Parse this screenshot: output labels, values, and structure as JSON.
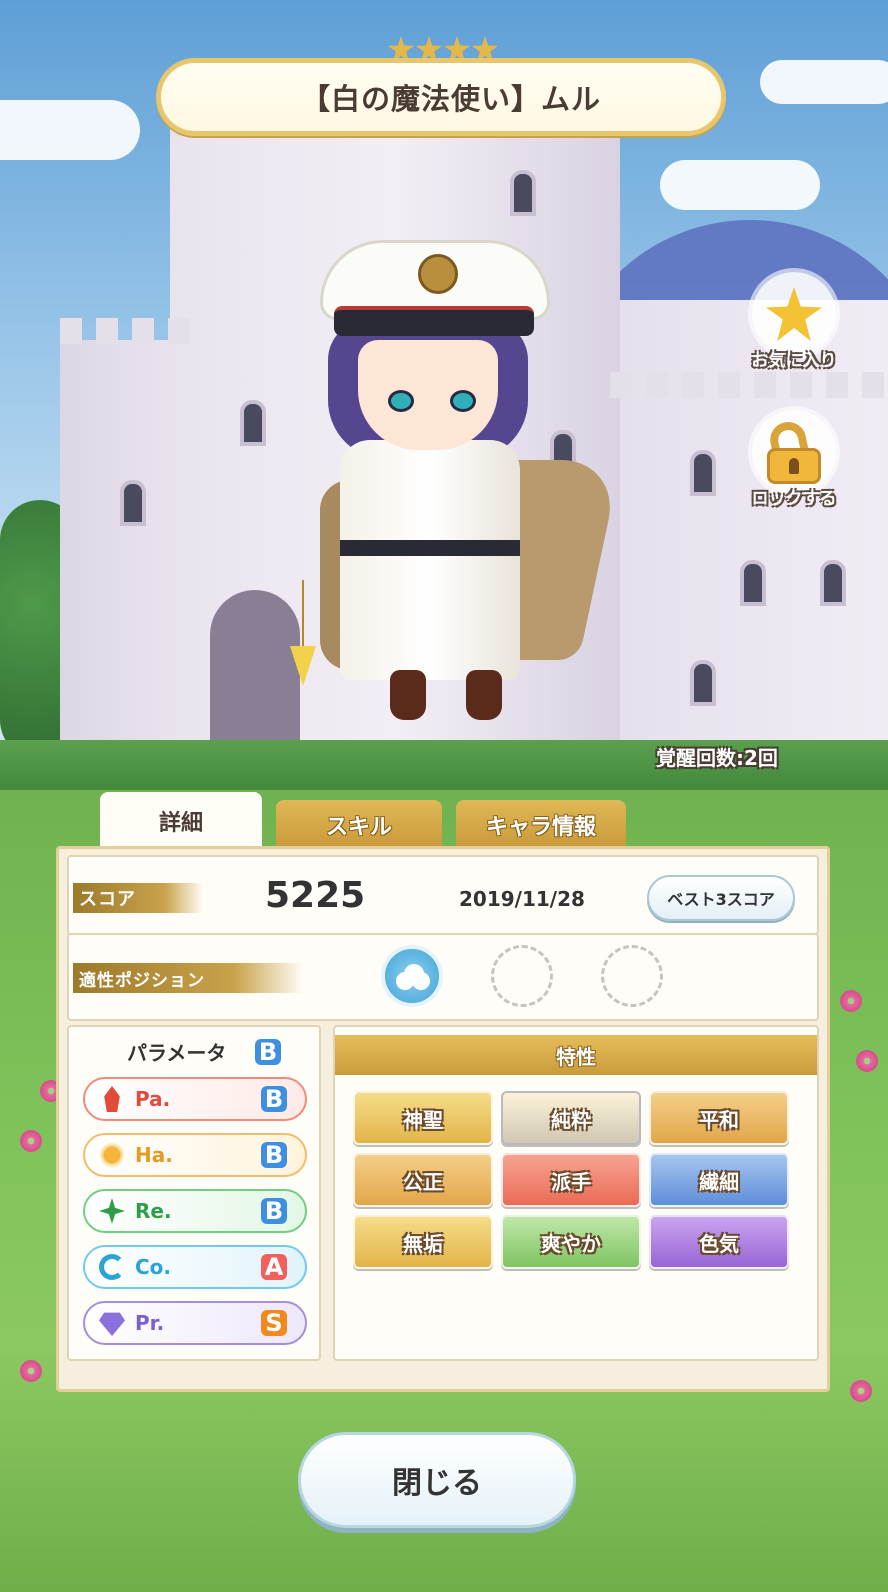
{
  "card": {
    "title": "【白の魔法使い】ムル",
    "rarity_stars": 4,
    "awaken": "覚醒回数:2回"
  },
  "side_buttons": {
    "favorite_label": "お気に入り",
    "lock_label": "ロックする"
  },
  "tabs": [
    {
      "label": "詳細",
      "active": true
    },
    {
      "label": "スキル",
      "active": false
    },
    {
      "label": "キャラ情報",
      "active": false
    }
  ],
  "score": {
    "label": "スコア",
    "value": "5225",
    "date": "2019/11/28",
    "best_button": "ベスト3スコア"
  },
  "position": {
    "label": "適性ポジション",
    "slots": [
      "cloud-icon",
      "",
      ""
    ]
  },
  "params": {
    "title": "パラメータ",
    "overall": "B",
    "rows": [
      {
        "name": "Pa.",
        "grade": "B",
        "icon": "flame-icon",
        "color": "#e24a3a"
      },
      {
        "name": "Ha.",
        "grade": "B",
        "icon": "sun-icon",
        "color": "#e59a22"
      },
      {
        "name": "Re.",
        "grade": "B",
        "icon": "clover-icon",
        "color": "#2f9e4a"
      },
      {
        "name": "Co.",
        "grade": "A",
        "icon": "swirl-icon",
        "color": "#2aa4d6"
      },
      {
        "name": "Pr.",
        "grade": "S",
        "icon": "diamond-icon",
        "color": "#7a5fcf"
      }
    ]
  },
  "traits": {
    "title": "特性",
    "items": [
      {
        "label": "神聖",
        "color": "#e9c35a"
      },
      {
        "label": "純粋",
        "color": "#d4d4d8"
      },
      {
        "label": "平和",
        "color": "#e9b45a"
      },
      {
        "label": "公正",
        "color": "#e9b45a"
      },
      {
        "label": "派手",
        "color": "#ef7a66"
      },
      {
        "label": "繊細",
        "color": "#6f9be0"
      },
      {
        "label": "無垢",
        "color": "#e9c35a"
      },
      {
        "label": "爽やか",
        "color": "#8fcf73"
      },
      {
        "label": "色気",
        "color": "#a774d8"
      }
    ]
  },
  "close_button": "閉じる"
}
